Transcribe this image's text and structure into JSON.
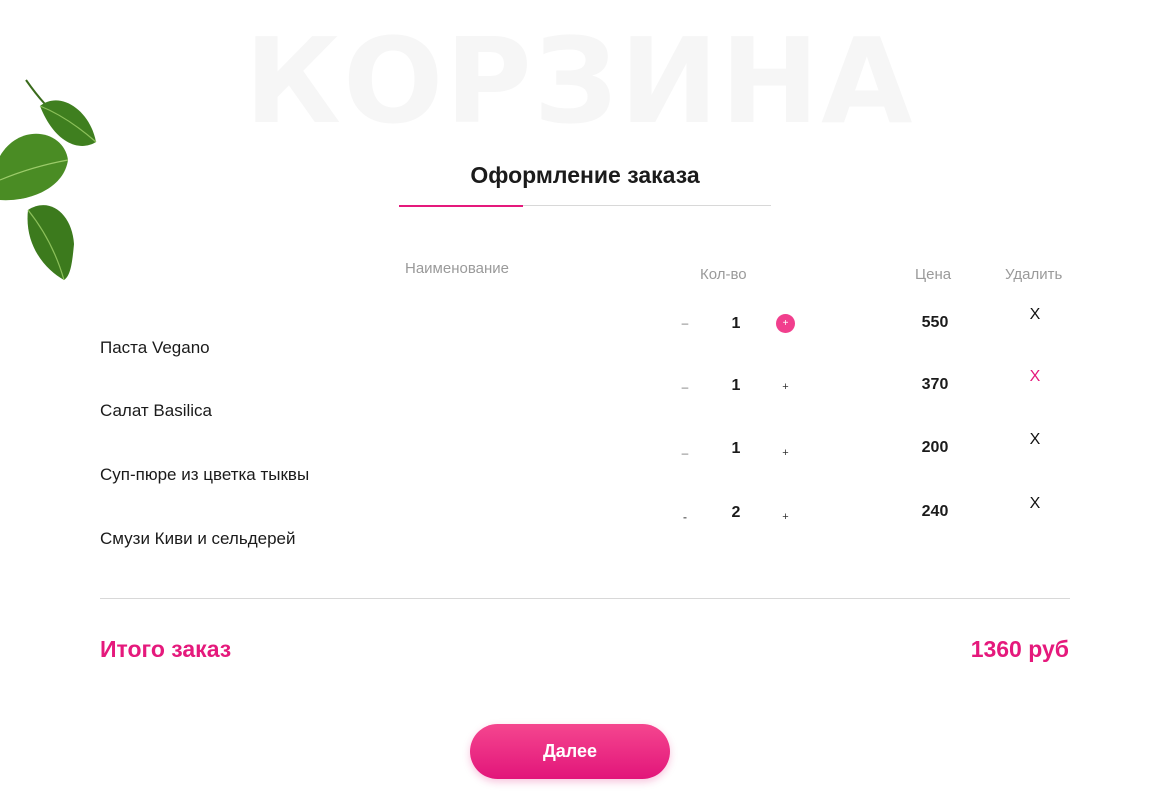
{
  "page": {
    "watermark": "КОРЗИНА",
    "title": "Оформление заказа"
  },
  "table": {
    "headers": {
      "name": "Наименование",
      "qty": "Кол-во",
      "price": "Цена",
      "delete": "Удалить"
    },
    "rows": [
      {
        "name": "Паста Vegano",
        "minus": "–",
        "qty": "1",
        "plus": "+",
        "price": "550",
        "delete": "X"
      },
      {
        "name": "Салат Basilica",
        "minus": "–",
        "qty": "1",
        "plus": "+",
        "price": "370",
        "delete": "X"
      },
      {
        "name": "Суп-пюре из цветка тыквы",
        "minus": "–",
        "qty": "1",
        "plus": "+",
        "price": "200",
        "delete": "X"
      },
      {
        "name": "Смузи Киви и сельдерей",
        "minus": "-",
        "qty": "2",
        "plus": "+",
        "price": "240",
        "delete": "X"
      }
    ]
  },
  "summary": {
    "label": "Итого заказ",
    "value": "1360 руб"
  },
  "actions": {
    "next_label": "Далее"
  },
  "icons": {
    "decor": "basil-leaves-icon"
  },
  "colors": {
    "accent": "#e5197c",
    "accent_light": "#f13f8d",
    "watermark": "#f6f6f6"
  }
}
